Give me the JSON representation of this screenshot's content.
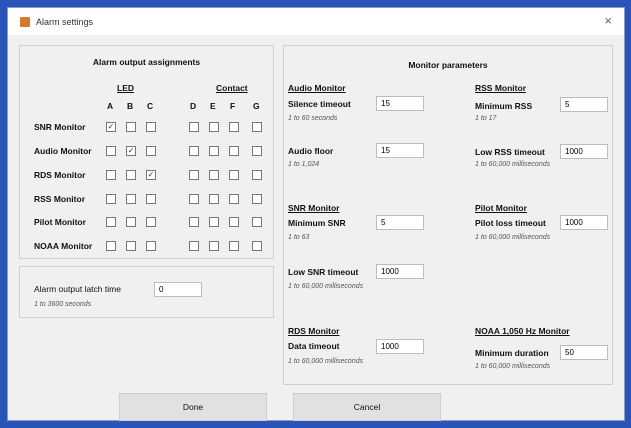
{
  "window": {
    "title": "Alarm settings",
    "close": "×"
  },
  "alarm": {
    "title": "Alarm output assignments",
    "led_label": "LED",
    "contact_label": "Contact",
    "cols": [
      "A",
      "B",
      "C",
      "D",
      "E",
      "F",
      "G"
    ],
    "rows": [
      {
        "label": "SNR Monitor",
        "checked": [
          true,
          false,
          false,
          false,
          false,
          false,
          false
        ]
      },
      {
        "label": "Audio Monitor",
        "checked": [
          false,
          true,
          false,
          false,
          false,
          false,
          false
        ]
      },
      {
        "label": "RDS Monitor",
        "checked": [
          false,
          false,
          true,
          false,
          false,
          false,
          false
        ]
      },
      {
        "label": "RSS Monitor",
        "checked": [
          false,
          false,
          false,
          false,
          false,
          false,
          false
        ]
      },
      {
        "label": "Pilot Monitor",
        "checked": [
          false,
          false,
          false,
          false,
          false,
          false,
          false
        ]
      },
      {
        "label": "NOAA Monitor",
        "checked": [
          false,
          false,
          false,
          false,
          false,
          false,
          false
        ]
      }
    ]
  },
  "latch": {
    "label": "Alarm output latch time",
    "value": "0",
    "hint": "1 to 3600 seconds"
  },
  "monitor": {
    "title": "Monitor parameters",
    "audio": {
      "heading": "Audio Monitor",
      "silence_label": "Silence timeout",
      "silence_value": "15",
      "silence_hint": "1 to 60 seconds",
      "floor_label": "Audio floor",
      "floor_value": "15",
      "floor_hint": "1 to 1,024"
    },
    "rss": {
      "heading": "RSS Monitor",
      "min_label": "Minimum RSS",
      "min_value": "5",
      "min_hint": "1 to 17",
      "low_label": "Low RSS timeout",
      "low_value": "1000",
      "low_hint": "1 to 60,000 milliseconds"
    },
    "snr": {
      "heading": "SNR Monitor",
      "min_label": "Minimum SNR",
      "min_value": "5",
      "min_hint": "1 to 63",
      "low_label": "Low SNR timeout",
      "low_value": "1000",
      "low_hint": "1 to 60,000 milliseconds"
    },
    "pilot": {
      "heading": "Pilot Monitor",
      "loss_label": "Pilot loss timeout",
      "loss_value": "1000",
      "loss_hint": "1 to 60,000 milliseconds"
    },
    "rds": {
      "heading": "RDS Monitor",
      "data_label": "Data timeout",
      "data_value": "1000",
      "data_hint": "1 to 60,000 milliseconds"
    },
    "noaa": {
      "heading": "NOAA 1,050 Hz Monitor",
      "min_label": "Minimum duration",
      "min_value": "50",
      "min_hint": "1 to 60,000 milliseconds"
    }
  },
  "buttons": {
    "done": "Done",
    "cancel": "Cancel"
  }
}
